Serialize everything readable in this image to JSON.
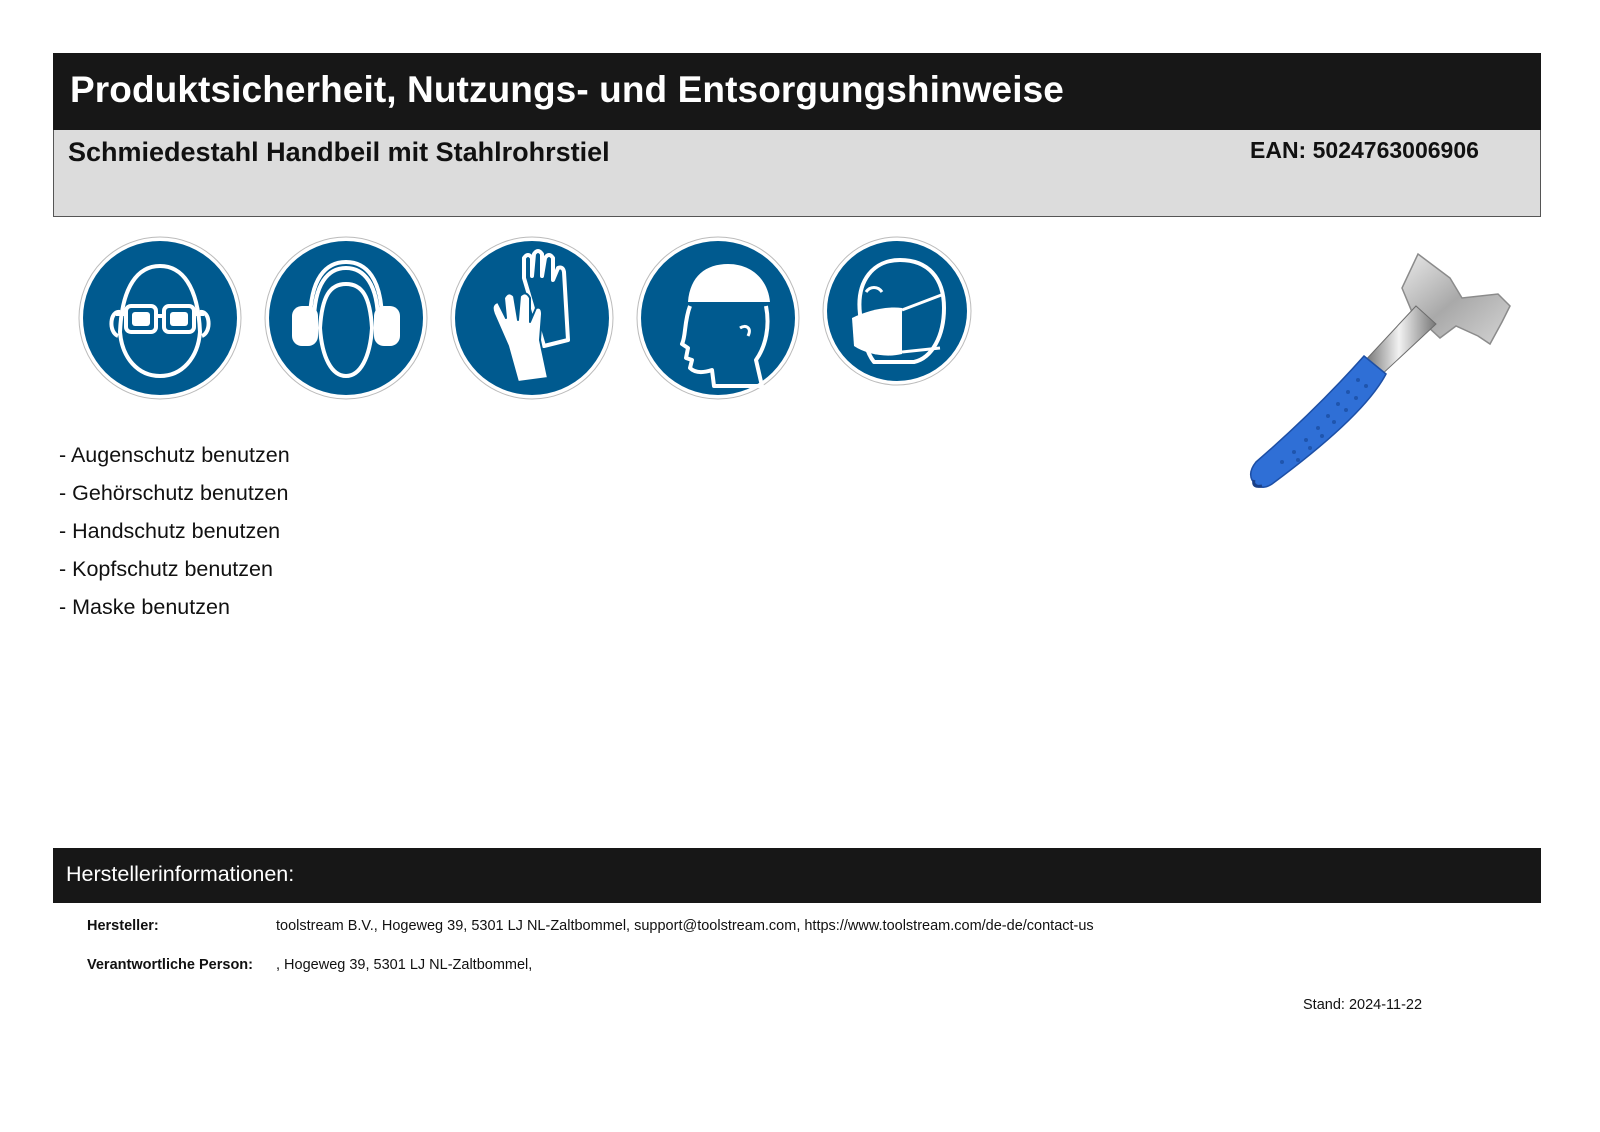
{
  "header": {
    "title": "Produktsicherheit, Nutzungs- und Entsorgungshinweise",
    "product_name": "Schmiedestahl Handbeil mit Stahlrohrstiel",
    "ean": "EAN: 5024763006906"
  },
  "safety_signs": [
    {
      "icon": "eye-protection-icon"
    },
    {
      "icon": "ear-protection-icon"
    },
    {
      "icon": "hand-protection-icon"
    },
    {
      "icon": "head-protection-icon"
    },
    {
      "icon": "mask-icon"
    }
  ],
  "sign_color": "#005a8f",
  "ppe_items": [
    "- Augenschutz benutzen",
    "- Gehörschutz benutzen",
    "- Handschutz benutzen",
    "- Kopfschutz benutzen",
    "- Maske benutzen"
  ],
  "product_image": {
    "icon": "hatchet-icon",
    "handle_color": "#2f6fd6"
  },
  "manufacturer": {
    "heading": "Herstellerinformationen:",
    "rows": [
      {
        "label": "Hersteller:",
        "value": "toolstream B.V., Hogeweg 39, 5301 LJ NL-Zaltbommel, support@toolstream.com, https://www.toolstream.com/de-de/contact-us"
      },
      {
        "label": "Verantwortliche Person:",
        "value": ", Hogeweg 39, 5301 LJ NL-Zaltbommel,"
      }
    ]
  },
  "stand": "Stand: 2024-11-22"
}
